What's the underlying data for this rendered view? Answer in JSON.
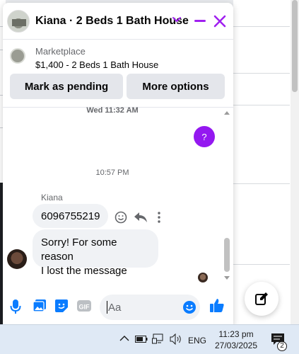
{
  "chat": {
    "title": "Kiana · 2 Beds 1 Bath House",
    "accent_color": "#a020f0"
  },
  "listing": {
    "source_label": "Marketplace",
    "price_title": "$1,400 - 2 Beds 1 Bath House",
    "pending_button": "Mark as pending",
    "options_button": "More options"
  },
  "messages": {
    "timestamp_top": "Wed 11:32 AM",
    "outgoing_text": "?",
    "timestamp_mid": "10:57 PM",
    "sender_name": "Kiana",
    "incoming_1": "6096755219",
    "incoming_2_line1": "Sorry! For some reason",
    "incoming_2_line2": "I lost the message"
  },
  "composer": {
    "placeholder": "Aa",
    "icons": [
      "microphone-icon",
      "image-icon",
      "sticker-icon",
      "gif-icon",
      "emoji-icon",
      "like-icon"
    ]
  },
  "taskbar": {
    "language": "ENG",
    "time": "11:23 pm",
    "date": "27/03/2025",
    "notification_count": "2"
  }
}
